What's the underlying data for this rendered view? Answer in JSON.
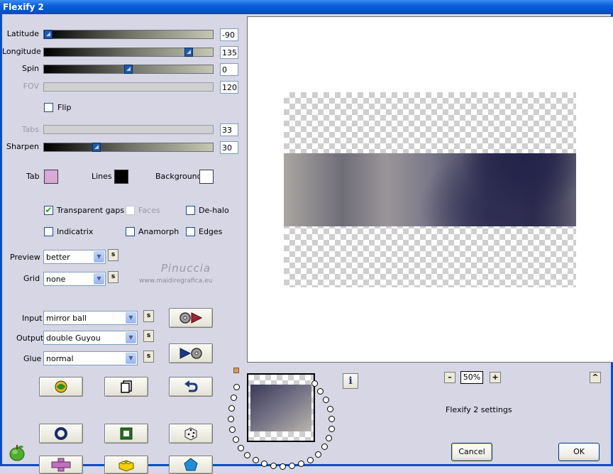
{
  "window": {
    "title": "Flexify 2"
  },
  "sliders": {
    "latitude": {
      "label": "Latitude",
      "value": "-90",
      "level": 0.0
    },
    "longitude": {
      "label": "Longitude",
      "value": "135",
      "level": 0.87
    },
    "spin": {
      "label": "Spin",
      "value": "0",
      "level": 0.5
    },
    "fov": {
      "label": "FOV",
      "value": "120",
      "level": null
    },
    "tabs": {
      "label": "Tabs",
      "value": "33",
      "level": null
    },
    "sharpen": {
      "label": "Sharpen",
      "value": "30",
      "level": 0.3
    }
  },
  "flip": {
    "label": "Flip",
    "checked": false
  },
  "colors": {
    "tab": {
      "label": "Tab",
      "color": "#d8a8d8"
    },
    "lines": {
      "label": "Lines",
      "color": "#000000"
    },
    "background": {
      "label": "Background",
      "color": "#ffffff"
    }
  },
  "options": {
    "transparent_gaps": {
      "label": "Transparent gaps",
      "checked": true
    },
    "faces": {
      "label": "Faces",
      "checked": false
    },
    "de_halo": {
      "label": "De-halo",
      "checked": false
    },
    "indicatrix": {
      "label": "Indicatrix",
      "checked": false
    },
    "anamorph": {
      "label": "Anamorph",
      "checked": false
    },
    "edges": {
      "label": "Edges",
      "checked": false
    }
  },
  "preview_quality": {
    "label": "Preview",
    "value": "better"
  },
  "grid": {
    "label": "Grid",
    "value": "none"
  },
  "watermark": {
    "name": "Pinuccia",
    "url": "www.maidiregrafica.eu"
  },
  "input": {
    "label": "Input",
    "value": "mirror ball"
  },
  "output": {
    "label": "Output",
    "value": "double Guyou"
  },
  "glue": {
    "label": "Glue",
    "value": "normal"
  },
  "s_button": "s",
  "zoom": {
    "minus": "–",
    "value": "50%",
    "plus": "+"
  },
  "info_icon": "i",
  "collapse": "^",
  "settings_label": "Flexify 2 settings",
  "buttons": {
    "cancel": "Cancel",
    "ok": "OK"
  },
  "icons": [
    "spiral-ball-icon",
    "copy-pages-icon",
    "undo-arrow-icon",
    "ring-icon",
    "square-frame-icon",
    "dice-icon",
    "cross-shape-icon",
    "lego-brick-icon",
    "pentagon-gem-icon",
    "apple-logo-icon"
  ]
}
